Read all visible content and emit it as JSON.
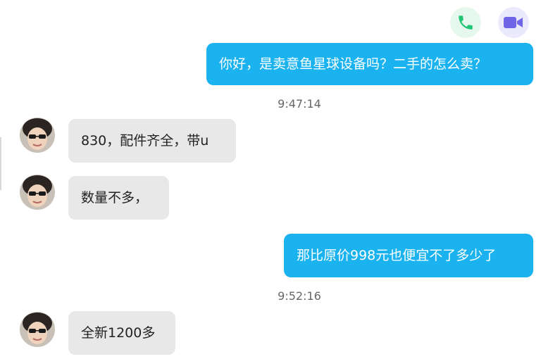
{
  "header": {
    "call_icon": "phone-icon",
    "video_icon": "video-camera-icon"
  },
  "colors": {
    "outgoing_bubble": "#1ab3f0",
    "incoming_bubble": "#e8e8e8",
    "phone_green": "#24c574",
    "video_purple": "#7065e6"
  },
  "messages": [
    {
      "direction": "outgoing",
      "text": "你好，是卖意鱼星球设备吗？二手的怎么卖？"
    },
    {
      "type": "timestamp",
      "text": "9:47:14"
    },
    {
      "direction": "incoming",
      "text": "830，配件齐全，带u"
    },
    {
      "direction": "incoming",
      "text": "数量不多，"
    },
    {
      "direction": "outgoing",
      "text": "那比原价998元也便宜不了多少了"
    },
    {
      "type": "timestamp",
      "text": "9:52:16"
    },
    {
      "direction": "incoming",
      "text": "全新1200多"
    }
  ]
}
